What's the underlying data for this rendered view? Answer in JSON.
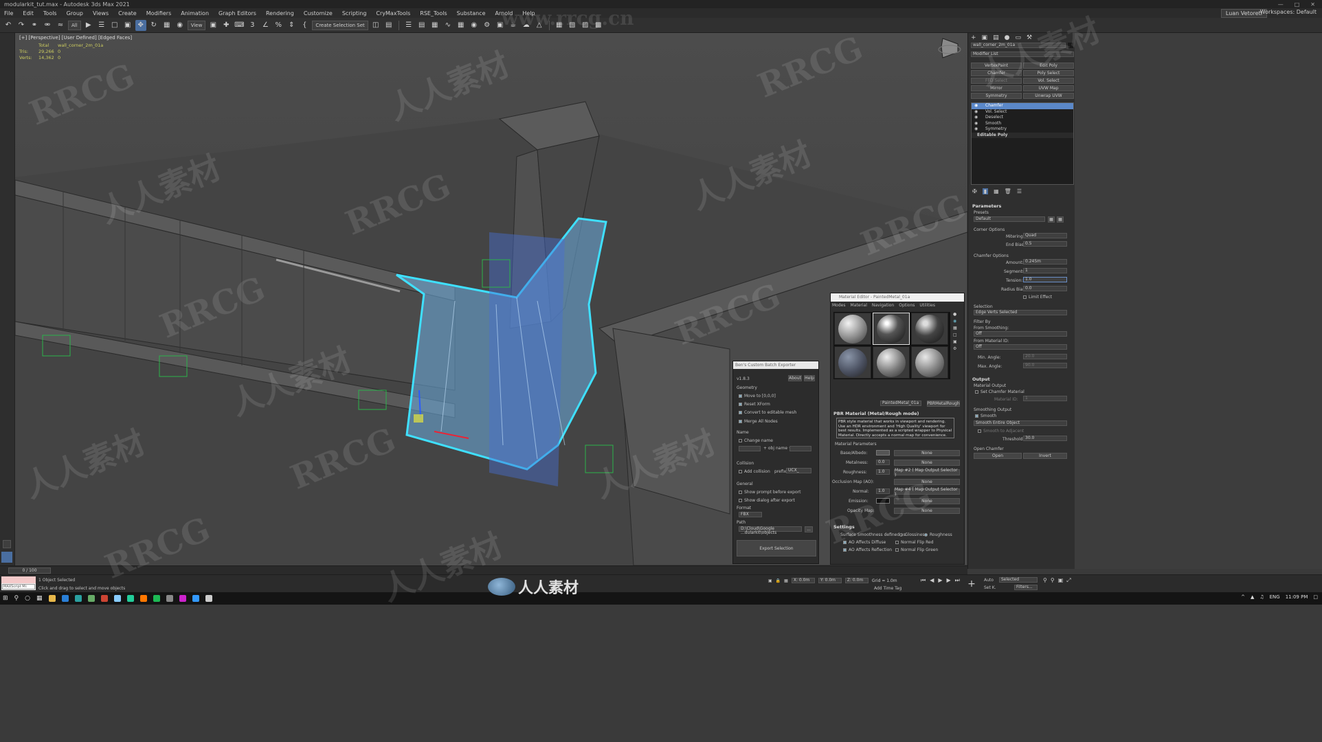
{
  "window": {
    "title": "modularkit_tut.max - Autodesk 3ds Max 2021"
  },
  "menu": [
    "File",
    "Edit",
    "Tools",
    "Group",
    "Views",
    "Create",
    "Modifiers",
    "Animation",
    "Graph Editors",
    "Rendering",
    "Customize",
    "Scripting",
    "CryMaxTools",
    "RSE_Tools",
    "Substance",
    "Arnold",
    "Help"
  ],
  "user": "Luan Vetoreti",
  "workspace": "Workspaces: Default",
  "toolbar": {
    "filter": "All",
    "refcoord": "View",
    "selset": "Create Selection Set"
  },
  "viewport": {
    "label": "[+] [Perspective] [User Defined] [Edged Faces]",
    "stats": {
      "total_label": "Total",
      "object": "wall_corner_2m_01a",
      "tris_label": "Tris:",
      "tris_total": "29,266",
      "tris_sel": "0",
      "verts_label": "Verts:",
      "verts_total": "14,362",
      "verts_sel": "0"
    }
  },
  "command_panel": {
    "object_name": "wall_corner_2m_01a",
    "modifier_list": "Modifier List",
    "modifier_buttons": [
      "VertexPaint",
      "Edit Poly",
      "Chamfer",
      "Poly Select",
      "FFD Select",
      "Vol. Select",
      "Mirror",
      "UVW Map",
      "Symmetry",
      "Unwrap UVW"
    ],
    "stack": [
      "Chamfer",
      "Vol. Select",
      "Deselect",
      "Smooth",
      "Symmetry"
    ],
    "base_object": "Editable Poly",
    "parameters": {
      "header": "Parameters",
      "presets_label": "Presets",
      "presets_value": "Default",
      "corner_options": "Corner Options",
      "mitering_label": "Mitering:",
      "mitering_value": "Quad",
      "end_bias_label": "End Bias:",
      "end_bias_value": "0.5",
      "chamfer_options": "Chamfer Options",
      "amount_label": "Amount:",
      "amount_value": "0.245m",
      "segments_label": "Segments:",
      "segments_value": "1",
      "tension_label": "Tension:",
      "tension_value": "1.0",
      "radius_bias_label": "Radius Bias:",
      "radius_bias_value": "0.0",
      "limit_effect": "Limit Effect",
      "selection_label": "Selection",
      "selection_value": "Edge Verts Selected",
      "filter_by": "Filter By",
      "from_smoothing": "From Smoothing:",
      "off1": "Off",
      "from_material": "From Material ID:",
      "off2": "Off",
      "min_angle_label": "Min. Angle:",
      "min_angle_value": "20.0",
      "max_angle_label": "Max. Angle:",
      "max_angle_value": "90.0",
      "output_header": "Output",
      "material_output": "Material Output",
      "set_chamfer_material": "Set Chamfer Material",
      "material_id_label": "Material ID:",
      "material_id_value": "1",
      "smoothing_output": "Smoothing Output",
      "smooth": "Smooth",
      "smooth_entire": "Smooth Entire Object",
      "smooth_to_adjacent": "Smooth to Adjacent",
      "threshold_label": "Threshold:",
      "threshold_value": "30.0",
      "open_chamfer": "Open Chamfer",
      "open_btn": "Open",
      "invert_btn": "Invert"
    }
  },
  "exporter": {
    "title": "Ben's Custom Batch Exporter",
    "version": "v1.8.3",
    "about": "About",
    "help": "Help",
    "geometry": "Geometry",
    "move_to_origin": "Move to [0,0,0]",
    "reset_xform": "Reset XForm",
    "convert_editable": "Convert to editable mesh",
    "merge_nodes": "Merge All Nodes",
    "name": "Name",
    "change_name": "Change name",
    "obj_name": "+ obj name +",
    "collision": "Collision",
    "add_collision": "Add collision",
    "prefix_label": "prefix",
    "prefix_value": "UCX_",
    "general": "General",
    "show_prompt": "Show prompt before export",
    "show_dialog": "Show dialog after export",
    "format_label": "Format",
    "format_value": "FBX",
    "path_label": "Path",
    "path_value": "D:\\Cloud\\Google ...dularkit\\objects",
    "browse": "...",
    "export_btn": "Export Selection"
  },
  "material_editor": {
    "title": "Material Editor - PaintedMetal_01a",
    "menu": [
      "Modes",
      "Material",
      "Navigation",
      "Options",
      "Utilities"
    ],
    "material_name": "PaintedMetal_01a",
    "material_type": "PBRMetalRough",
    "rollout": "PBR Material (Metal/Rough mode)",
    "description": "PBR style material that works in viewport and rendering. Use an HDR environment and 'High Quality' viewport for best results. Implemented as a scripted wrapper to Physical Material. Directly accepts a normal map for convenience.",
    "params_label": "Material Parameters",
    "rows": [
      {
        "label": "Base/Albedo:",
        "value": "",
        "map": "None"
      },
      {
        "label": "Metalness:",
        "value": "0.0",
        "map": "None"
      },
      {
        "label": "Roughness:",
        "value": "1.0",
        "map": "Map #2 ( Map Output Selector )"
      },
      {
        "label": "Occlusion Map (AO):",
        "value": "",
        "map": "None"
      },
      {
        "label": "Normal:",
        "value": "1.0",
        "map": "Map #4 ( Map Output Selector )"
      },
      {
        "label": "Emission:",
        "value": "",
        "map": "None"
      },
      {
        "label": "Opacity Map:",
        "value": "",
        "map": "None"
      }
    ],
    "settings": "Settings",
    "smoothness_label": "Surface Smoothness defined as",
    "glossiness": "Glossiness",
    "roughness": "Roughness",
    "ao_diffuse": "AO Affects Diffuse",
    "ao_reflection": "AO Affects Reflection",
    "flip_red": "Normal Flip Red",
    "flip_green": "Normal Flip Green"
  },
  "timeline": {
    "frame": "0 / 100"
  },
  "status": {
    "maxscript": "MAXScript Mi:",
    "selected": "1 Object Selected",
    "prompt": "Click and drag to select and move objects",
    "x": "X: 0.0m",
    "y": "Y: 0.0m",
    "z": "Z: 0.0m",
    "grid": "Grid = 1.0m",
    "add_time_tag": "Add Time Tag",
    "auto": "Auto",
    "set_key": "Set K.",
    "selected_dd": "Selected",
    "filters": "Filters..."
  },
  "taskbar": {
    "lang": "ENG",
    "time": "11:09 PM"
  },
  "watermark": {
    "site": "www.rrcg.cn",
    "latin": "RRCG",
    "cn": "人人素材"
  }
}
